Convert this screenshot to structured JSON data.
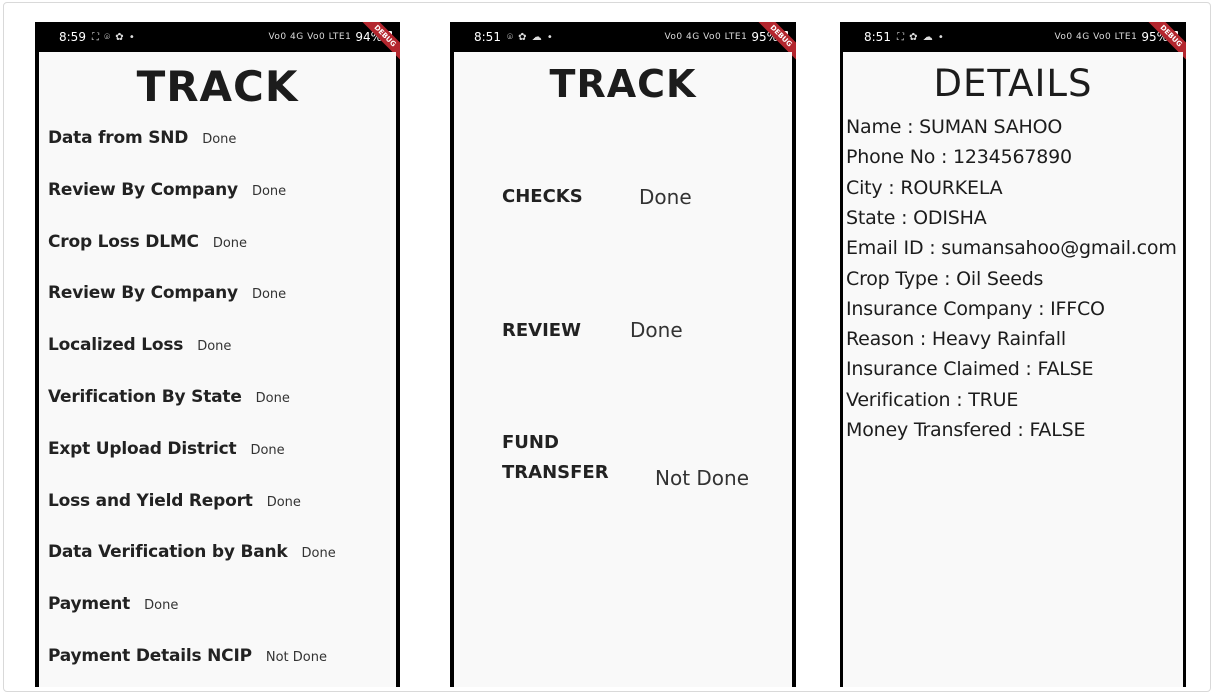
{
  "phone1": {
    "status_time": "8:59",
    "status_icons": "⛶ ⌾ ✿ •",
    "status_signal": "Vo0 4G Vo0 LTE1",
    "status_battery": "94%",
    "debug_label": "DEBUG",
    "title": "TRACK",
    "rows": [
      {
        "label": "Data from SND",
        "status": "Done"
      },
      {
        "label": "Review By Company",
        "status": "Done"
      },
      {
        "label": "Crop Loss DLMC",
        "status": "Done"
      },
      {
        "label": "Review By Company",
        "status": "Done"
      },
      {
        "label": "Localized Loss",
        "status": "Done"
      },
      {
        "label": "Verification By State",
        "status": "Done"
      },
      {
        "label": "Expt Upload District",
        "status": "Done"
      },
      {
        "label": "Loss and Yield Report",
        "status": "Done"
      },
      {
        "label": "Data Verification by Bank",
        "status": "Done"
      },
      {
        "label": "Payment",
        "status": "Done"
      },
      {
        "label": "Payment Details NCIP",
        "status": "Not Done"
      }
    ]
  },
  "phone2": {
    "status_time": "8:51",
    "status_icons": "⌾ ✿ ☁ •",
    "status_signal": "Vo0 4G Vo0 LTE1",
    "status_battery": "95%",
    "debug_label": "DEBUG",
    "title": "TRACK",
    "checks": {
      "label": "CHECKS",
      "status": "Done"
    },
    "review": {
      "label": "REVIEW",
      "status": "Done"
    },
    "fund": {
      "label_line1": "FUND",
      "label_line2": "TRANSFER",
      "status": "Not Done"
    }
  },
  "phone3": {
    "status_time": "8:51",
    "status_icons": "⛶ ✿ ☁ •",
    "status_signal": "Vo0 4G Vo0 LTE1",
    "status_battery": "95%",
    "debug_label": "DEBUG",
    "title": "DETAILS",
    "lines": [
      "Name : SUMAN SAHOO",
      "Phone No : 1234567890",
      "City : ROURKELA",
      "State : ODISHA",
      "Email ID : sumansahoo@gmail.com",
      "Crop Type : Oil Seeds",
      "Insurance Company : IFFCO",
      "Reason : Heavy Rainfall",
      "Insurance Claimed : FALSE",
      "Verification : TRUE",
      "Money Transfered : FALSE"
    ]
  }
}
